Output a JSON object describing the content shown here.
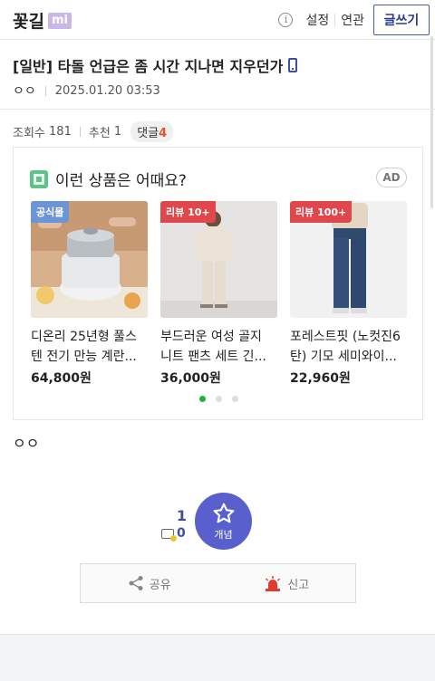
{
  "header": {
    "logo_text": "꽃길",
    "logo_badge": "mi",
    "info_icon": "info-icon",
    "settings_label": "설정",
    "related_label": "연관",
    "write_button_label": "글쓰기"
  },
  "post": {
    "title": "[일반] 타돌 언급은 좀 시간 지나면 지우던가",
    "author": "ㅇㅇ",
    "datetime": "2025.01.20 03:53",
    "views_label": "조회수",
    "views": "181",
    "recommend_label": "추천",
    "recommend": "1",
    "comments_label": "댓글",
    "comments": "4",
    "body": "ㅇㅇ"
  },
  "ad": {
    "heading": "이런 상품은 어때요?",
    "tag": "AD",
    "products": [
      {
        "badge": "공식몰",
        "name": "디온리 25년형 풀스텐 전기 만능 계란...",
        "price": "64,800원"
      },
      {
        "badge": "리뷰 10+",
        "name": "부드러운 여성 골지 니트 팬츠 세트 긴...",
        "price": "36,000원"
      },
      {
        "badge": "리뷰 100+",
        "name": "포레스트핏 (노컷진6탄) 기모 세미와이...",
        "price": "22,960원"
      }
    ]
  },
  "vote": {
    "up_count": "1",
    "down_count": "0",
    "button_label": "개념"
  },
  "actions": {
    "share_label": "공유",
    "report_label": "신고"
  },
  "colors": {
    "brand": "#3e4fa3",
    "vote_circle": "#5a5fce",
    "comment_count": "#e0532b",
    "report_icon": "#e23b2e"
  }
}
